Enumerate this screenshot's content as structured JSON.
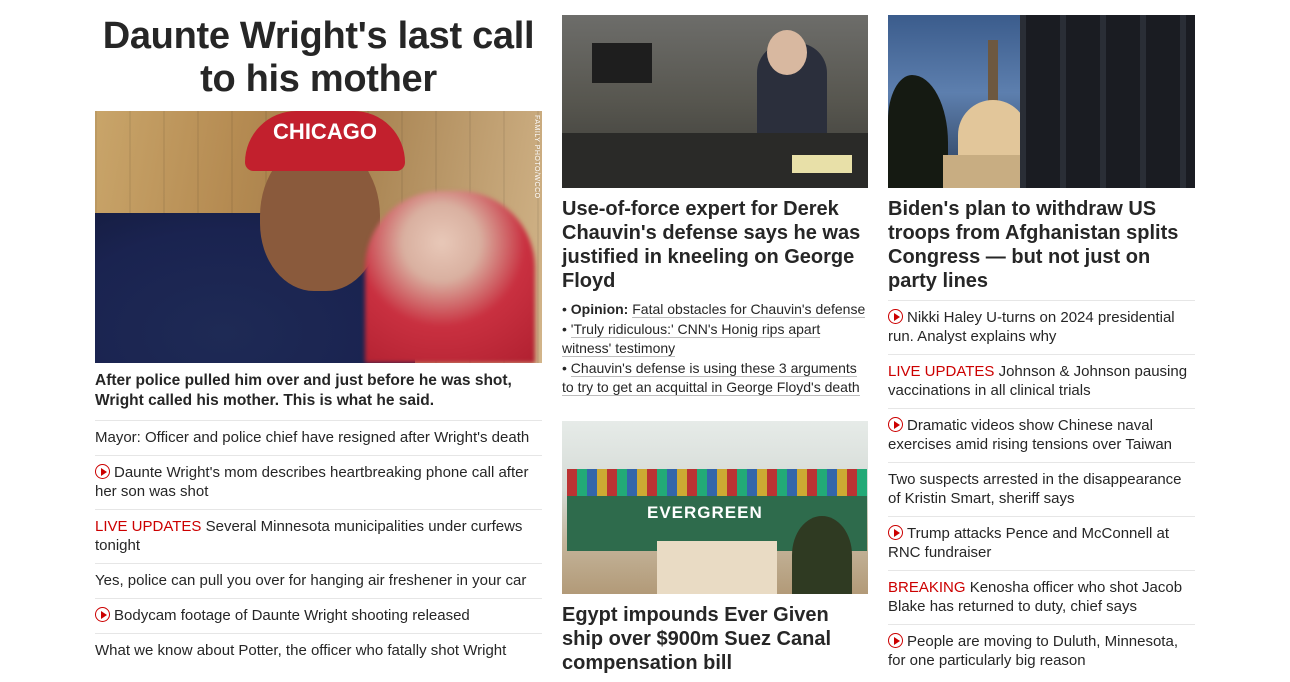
{
  "lead": {
    "title": "Daunte Wright's last call to his mother",
    "image_alt": "Daunte Wright photo",
    "image_credit": "FAMILY PHOTO/WCCO",
    "cap_text": "CHICAGO",
    "subhead": "After police pulled him over and just before he was shot, Wright called his mother. This is what he said.",
    "items": [
      {
        "prefix": "",
        "icon": "",
        "text": "Mayor: Officer and police chief have resigned after Wright's death"
      },
      {
        "prefix": "",
        "icon": "play-icon",
        "text": "Daunte Wright's mom describes heartbreaking phone call after her son was shot"
      },
      {
        "prefix": "LIVE UPDATES",
        "icon": "",
        "text": "Several Minnesota municipalities under curfews tonight"
      },
      {
        "prefix": "",
        "icon": "",
        "text": "Yes, police can pull you over for hanging air freshener in your car"
      },
      {
        "prefix": "",
        "icon": "play-icon",
        "text": "Bodycam footage of Daunte Wright shooting released"
      },
      {
        "prefix": "",
        "icon": "",
        "text": "What we know about Potter, the officer who fatally shot Wright"
      }
    ]
  },
  "chauvin": {
    "headline": "Use-of-force expert for Derek Chauvin's defense says he was justified in kneeling on George Floyd",
    "bullets": [
      {
        "bold": "Opinion:",
        "text": "Fatal obstacles for Chauvin's defense"
      },
      {
        "bold": "",
        "text": "'Truly ridiculous:' CNN's Honig rips apart witness' testimony"
      },
      {
        "bold": "",
        "text": "Chauvin's defense is using these 3 arguments to try to get an acquittal in George Floyd's death"
      }
    ]
  },
  "egypt": {
    "headline": "Egypt impounds Ever Given ship over $900m Suez Canal compensation bill",
    "ship_text": "EVERGREEN"
  },
  "biden": {
    "headline": "Biden's plan to withdraw US troops from Afghanistan splits Congress — but not just on party lines",
    "items": [
      {
        "prefix": "",
        "icon": "play-icon",
        "text": "Nikki Haley U-turns on 2024 presidential run. Analyst explains why"
      },
      {
        "prefix": "LIVE UPDATES",
        "icon": "",
        "text": "Johnson & Johnson pausing vaccinations in all clinical trials"
      },
      {
        "prefix": "",
        "icon": "play-icon",
        "text": "Dramatic videos show Chinese naval exercises amid rising tensions over Taiwan"
      },
      {
        "prefix": "",
        "icon": "",
        "text": "Two suspects arrested in the disappearance of Kristin Smart, sheriff says"
      },
      {
        "prefix": "",
        "icon": "play-icon",
        "text": "Trump attacks Pence and McConnell at RNC fundraiser"
      },
      {
        "prefix": "BREAKING",
        "icon": "",
        "text": "Kenosha officer who shot Jacob Blake has returned to duty, chief says"
      },
      {
        "prefix": "",
        "icon": "play-icon",
        "text": "People are moving to Duluth, Minnesota, for one particularly big reason"
      }
    ]
  },
  "colors": {
    "accent_red": "#cc0000",
    "text": "#262626",
    "divider": "#e6e6e6"
  }
}
